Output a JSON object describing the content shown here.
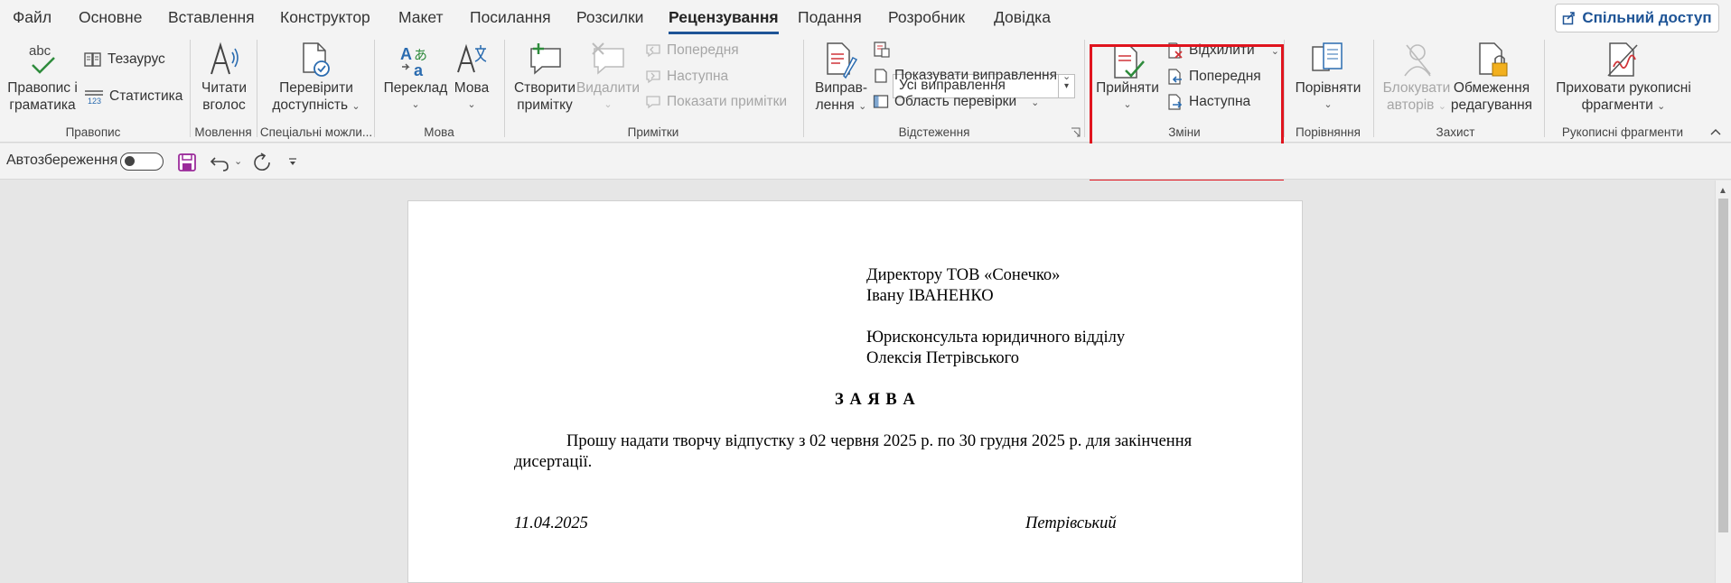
{
  "menu": {
    "tabs": [
      "Файл",
      "Основне",
      "Вставлення",
      "Конструктор",
      "Макет",
      "Посилання",
      "Розсилки",
      "Рецензування",
      "Подання",
      "Розробник",
      "Довідка"
    ],
    "active_tab": "Рецензування",
    "share_label": "Спільний доступ"
  },
  "ribbon": {
    "spelling": {
      "line1": "Правопис і",
      "line2": "граматика",
      "thesaurus": "Тезаурус",
      "stats": "Статистика",
      "group": "Правопис"
    },
    "speech": {
      "line1": "Читати",
      "line2": "вголос",
      "group": "Мовлення"
    },
    "accessibility": {
      "line1": "Перевірити",
      "line2": "доступність",
      "group": "Спеціальні можли..."
    },
    "language": {
      "translate": "Переклад",
      "lang": "Мова",
      "group": "Мова"
    },
    "comments": {
      "new1": "Створити",
      "new2": "примітку",
      "delete": "Видалити",
      "previous": "Попередня",
      "next": "Наступна",
      "show": "Показати примітки",
      "group": "Примітки"
    },
    "tracking": {
      "track1": "Виправ-",
      "track2": "лення",
      "markup_value": "Усі виправлення",
      "show_markup": "Показувати виправлення",
      "pane": "Область перевірки",
      "group": "Відстеження"
    },
    "changes": {
      "accept": "Прийняти",
      "reject": "Відхилити",
      "previous": "Попередня",
      "next": "Наступна",
      "group": "Зміни"
    },
    "compare": {
      "label": "Порівняти",
      "group": "Порівняння"
    },
    "protect": {
      "block1": "Блокувати",
      "block2": "авторів",
      "restrict1": "Обмеження",
      "restrict2": "редагування",
      "group": "Захист"
    },
    "ink": {
      "line1": "Приховати рукописні",
      "line2": "фрагменти",
      "group": "Рукописні фрагменти"
    }
  },
  "qat": {
    "autosave_label": "Автозбереження"
  },
  "document": {
    "recipient1": "Директору ТОВ «Сонечко»",
    "recipient2": "Івану ІВАНЕНКО",
    "sender1": "Юрисконсульта юридичного відділу",
    "sender2": "Олексія Петрівського",
    "title": "З А Я В А",
    "body1": "Прошу надати творчу відпустку з 02 червня 2025 р. по 30 грудня 2025 р. для закінчення",
    "body2": "дисертації.",
    "date": "11.04.2025",
    "signature": "Петрівський"
  },
  "colors": {
    "accent": "#1e5496",
    "highlight_box": "#e0141e"
  }
}
